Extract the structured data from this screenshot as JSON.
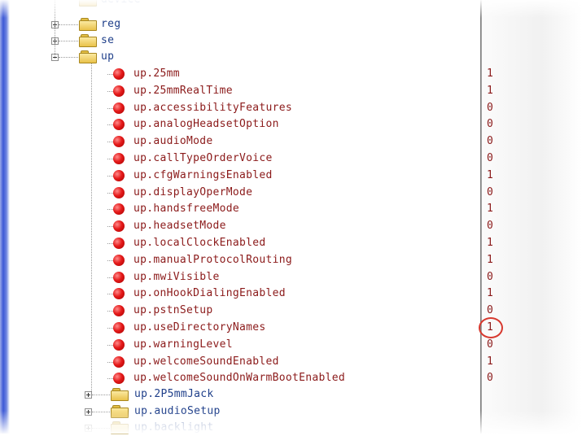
{
  "top_partial": {
    "label": "device"
  },
  "folders_before": [
    {
      "name": "reg",
      "expanded": false
    },
    {
      "name": "se",
      "expanded": false
    },
    {
      "name": "up",
      "expanded": true
    }
  ],
  "params": [
    {
      "name": "up.25mm",
      "value": "1"
    },
    {
      "name": "up.25mmRealTime",
      "value": "1"
    },
    {
      "name": "up.accessibilityFeatures",
      "value": "0"
    },
    {
      "name": "up.analogHeadsetOption",
      "value": "0"
    },
    {
      "name": "up.audioMode",
      "value": "0"
    },
    {
      "name": "up.callTypeOrderVoice",
      "value": "0"
    },
    {
      "name": "up.cfgWarningsEnabled",
      "value": "1"
    },
    {
      "name": "up.displayOperMode",
      "value": "0"
    },
    {
      "name": "up.handsfreeMode",
      "value": "1"
    },
    {
      "name": "up.headsetMode",
      "value": "0"
    },
    {
      "name": "up.localClockEnabled",
      "value": "1"
    },
    {
      "name": "up.manualProtocolRouting",
      "value": "1"
    },
    {
      "name": "up.mwiVisible",
      "value": "0"
    },
    {
      "name": "up.onHookDialingEnabled",
      "value": "1"
    },
    {
      "name": "up.pstnSetup",
      "value": "0"
    },
    {
      "name": "up.useDirectoryNames",
      "value": "1",
      "highlighted": true
    },
    {
      "name": "up.warningLevel",
      "value": "0"
    },
    {
      "name": "up.welcomeSoundEnabled",
      "value": "1"
    },
    {
      "name": "up.welcomeSoundOnWarmBootEnabled",
      "value": "0"
    }
  ],
  "folders_after": [
    {
      "name": "up.2P5mmJack",
      "expanded": false
    },
    {
      "name": "up.audioSetup",
      "expanded": false
    },
    {
      "name": "up.backlight",
      "expanded": false
    }
  ],
  "colors": {
    "accent_circle": "#d7392f",
    "param_text": "#8b1a1a",
    "folder_text": "#1f3f8a"
  }
}
